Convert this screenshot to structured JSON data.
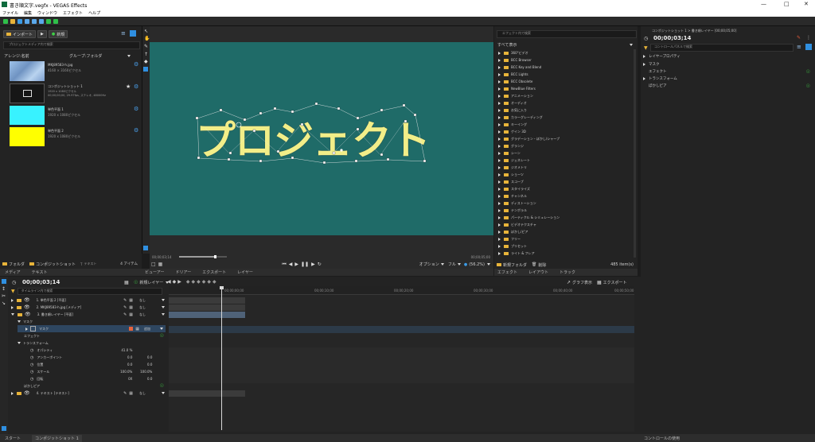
{
  "app": {
    "title": "書き順文字.vegfx - VEGAS Effects",
    "menu": [
      "ファイル",
      "編集",
      "ウィンドウ",
      "エフェクト",
      "ヘルプ"
    ]
  },
  "media": {
    "import_label": "インポート",
    "new_label": "新規",
    "search_placeholder": "プロジェクトメディア内で検索",
    "sort_label": "アレンジ:名前",
    "group_label": "グループ:フォルダ",
    "items": [
      {
        "name": "MKJ89583-h.jpg",
        "info": "4160 × 3160ピクセル",
        "thumb": "#8fb4db"
      },
      {
        "name": "コンポジットショット 1",
        "info": "1920 x 1080ピクセル\n00;00;00;00, 29.97fps, ステレオ, 48000Hz",
        "thumb": "#1a1a1a"
      },
      {
        "name": "単色平面 1",
        "info": "1920 x 1080ピクセル",
        "thumb": "#38f2ff"
      },
      {
        "name": "単色平面 2",
        "info": "1920 x 1080ピクセル",
        "thumb": "#ffff00"
      }
    ],
    "footer_folder": "フォルダ",
    "footer_comp": "コンポジットショット",
    "footer_text": "テキスト",
    "item_count": "4 アイテム",
    "tabs": [
      "メディア",
      "テキスト"
    ]
  },
  "viewer": {
    "canvas_text": "プロジェクト",
    "bg_color": "#1f6b68",
    "time_left": "00;00;03;14",
    "time_right": "00;00;05;00",
    "option_label": "オプション",
    "full_label": "フル",
    "zoom_label": "(56.2%)",
    "tabs": [
      "ビューアー",
      "ドリアー",
      "エクスポート",
      "レイヤー"
    ]
  },
  "effects": {
    "search_placeholder": "エフェクト内で検索",
    "show_all": "すべて表示",
    "items": [
      "360°ビデオ",
      "BCC Browser",
      "BCC Key and Blend",
      "BCC Lights",
      "BCC Obsolete",
      "NewBlue Filters",
      "アニメーション",
      "オーディオ",
      "お気に入り",
      "カラーグレーディング",
      "キーイング",
      "ゲイン 3D",
      "グラデーション・ぼかし/シャープ",
      "グランジ",
      "シーン",
      "ジェネレート",
      "ジオメトリ",
      "ショーツ",
      "スコープ",
      "スタイライズ",
      "チャンネル",
      "ディストーション",
      "テンポラル",
      "パーティクル & シミュレーション",
      "ビデオテクスチャ",
      "ぼかし/ピア",
      "フリー",
      "プリセット",
      "ライト & フレア"
    ],
    "footer_new_folder": "新規フォルダ",
    "footer_delete": "削除",
    "item_count": "485 item(s)",
    "tabs": [
      "エフェクト",
      "レイアウト",
      "トラック"
    ]
  },
  "controls": {
    "breadcrumb": "コンポジットショット 1 > 書き順レイヤー [00;00;05;00]",
    "time": "00;00;03;14",
    "search_placeholder": "コントロールパネルで検索",
    "items": [
      "レイヤープロパティ",
      "マスク",
      "エフェクト",
      "トランスフォーム",
      "ぼかしピア"
    ],
    "footer": "コントロールの使用"
  },
  "timeline": {
    "time": "00;00;03;14",
    "new_layer_label": "新規レイヤー",
    "search_placeholder": "タイムライン内で検索",
    "graph_label": "グラフ表示",
    "export_label": "エクスポート",
    "ruler": [
      "00;00;00;00",
      "00;00;10;00",
      "00;00;20;00",
      "00;00;30;00",
      "00;00;40;00",
      "00;00;50;00"
    ],
    "layers": [
      {
        "name": "1. 単色平面 2 [平面]",
        "mode": "なし"
      },
      {
        "name": "2. MKJ89583-h.jpg [メディア]",
        "mode": "なし"
      },
      {
        "name": "3. 書き順レイヤー [平面]",
        "mode": "なし"
      }
    ],
    "mask_label": "マスク",
    "mask_item": "マスク",
    "mask_mode": "追加",
    "effect_label": "エフェクト",
    "transform_label": "トランスフォーム",
    "props": [
      {
        "name": "オパシティ",
        "v1": "41.0 %",
        "v2": ""
      },
      {
        "name": "アンカーポイント",
        "v1": "0.0",
        "v2": "0.0"
      },
      {
        "name": "位置",
        "v1": "0.0",
        "v2": "0.0"
      },
      {
        "name": "スケール",
        "v1": "100.0%",
        "v2": "100.0%"
      },
      {
        "name": "回転",
        "v1": "0X",
        "v2": "0.0"
      }
    ],
    "blur_label": "ぼかしピア",
    "layer4": {
      "name": "4. テキスト [テキスト]",
      "mode": "なし"
    }
  },
  "bottom": {
    "start_tab": "スタート",
    "comp_tab": "コンポジットショット 1"
  }
}
